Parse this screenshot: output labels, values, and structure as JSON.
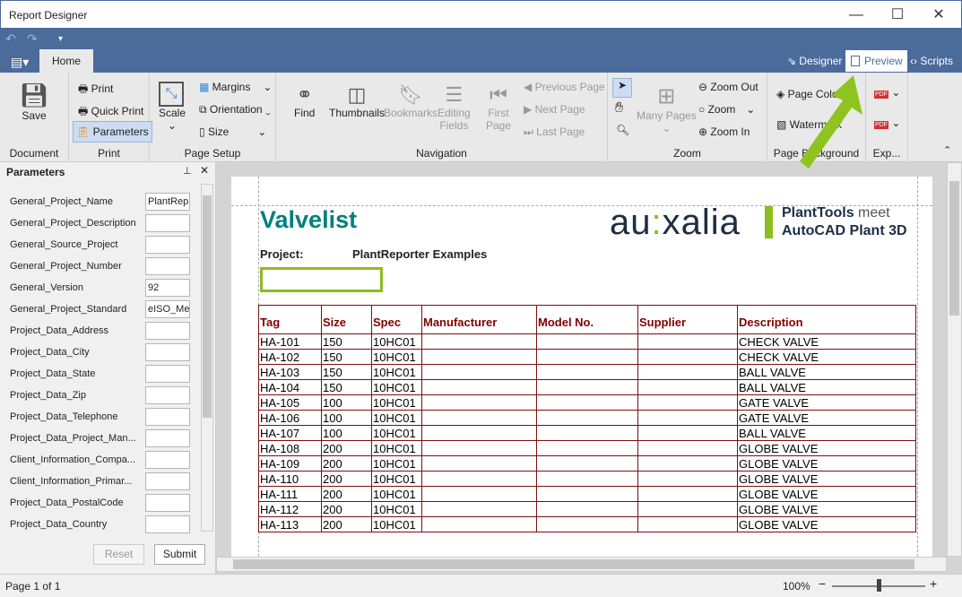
{
  "window": {
    "title": "Report Designer",
    "minimize": "—",
    "maximize": "☐",
    "close": "✕"
  },
  "quick_access": {
    "undo": "↶",
    "redo": "↷",
    "customize": "▾"
  },
  "tabs": [
    {
      "label": "Home"
    }
  ],
  "view_tabs": [
    {
      "label": "Designer",
      "icon": "designer-icon"
    },
    {
      "label": "Preview",
      "icon": "preview-icon"
    },
    {
      "label": "Scripts",
      "icon": "scripts-icon"
    }
  ],
  "ribbon": {
    "document": {
      "label": "Document",
      "save": "Save"
    },
    "print": {
      "label": "Print",
      "print": "Print",
      "quick_print": "Quick Print",
      "parameters": "Parameters"
    },
    "page_setup": {
      "label": "Page Setup",
      "scale": "Scale",
      "margins": "Margins",
      "orientation": "Orientation",
      "size": "Size"
    },
    "navigation": {
      "label": "Navigation",
      "find": "Find",
      "thumbnails": "Thumbnails",
      "bookmarks": "Bookmarks",
      "editing_fields_1": "Editing",
      "editing_fields_2": "Fields",
      "first_page_1": "First",
      "first_page_2": "Page",
      "previous_page": "Previous Page",
      "next_page": "Next Page",
      "last_page": "Last Page"
    },
    "zoom": {
      "label": "Zoom",
      "many_pages": "Many Pages",
      "zoom_out": "Zoom Out",
      "zoom": "Zoom",
      "zoom_in": "Zoom In"
    },
    "page_background": {
      "label": "Page Background",
      "page_color": "Page Color",
      "watermark": "Watermark"
    },
    "export": {
      "label": "Exp...",
      "pdf": "PDF"
    }
  },
  "parameters_panel": {
    "title": "Parameters",
    "reset": "Reset",
    "submit": "Submit",
    "items": [
      {
        "name": "General_Project_Name",
        "value": "PlantRep"
      },
      {
        "name": "General_Project_Description",
        "value": ""
      },
      {
        "name": "General_Source_Project",
        "value": ""
      },
      {
        "name": "General_Project_Number",
        "value": ""
      },
      {
        "name": "General_Version",
        "value": "92"
      },
      {
        "name": "General_Project_Standard",
        "value": "eISO_Me"
      },
      {
        "name": "Project_Data_Address",
        "value": ""
      },
      {
        "name": "Project_Data_City",
        "value": ""
      },
      {
        "name": "Project_Data_State",
        "value": ""
      },
      {
        "name": "Project_Data_Zip",
        "value": ""
      },
      {
        "name": "Project_Data_Telephone",
        "value": ""
      },
      {
        "name": "Project_Data_Project_Man...",
        "value": ""
      },
      {
        "name": "Client_Information_Compa...",
        "value": ""
      },
      {
        "name": "Client_Information_Primar...",
        "value": ""
      },
      {
        "name": "Project_Data_PostalCode",
        "value": ""
      },
      {
        "name": "Project_Data_Country",
        "value": ""
      }
    ]
  },
  "report": {
    "title": "Valvelist",
    "project_label": "Project:",
    "project_value": "PlantReporter Examples",
    "logo": {
      "brand": "au:xalia",
      "tagline1": "PlantTools meet",
      "tagline2": "AutoCAD Plant 3D"
    },
    "columns": [
      "Tag",
      "Size",
      "Spec",
      "Manufacturer",
      "Model No.",
      "Supplier",
      "Description"
    ],
    "rows": [
      [
        "HA-101",
        "150",
        "10HC01",
        "",
        "",
        "",
        "CHECK VALVE"
      ],
      [
        "HA-102",
        "150",
        "10HC01",
        "",
        "",
        "",
        "CHECK VALVE"
      ],
      [
        "HA-103",
        "150",
        "10HC01",
        "",
        "",
        "",
        "BALL VALVE"
      ],
      [
        "HA-104",
        "150",
        "10HC01",
        "",
        "",
        "",
        "BALL VALVE"
      ],
      [
        "HA-105",
        "100",
        "10HC01",
        "",
        "",
        "",
        "GATE VALVE"
      ],
      [
        "HA-106",
        "100",
        "10HC01",
        "",
        "",
        "",
        "GATE VALVE"
      ],
      [
        "HA-107",
        "100",
        "10HC01",
        "",
        "",
        "",
        "BALL VALVE"
      ],
      [
        "HA-108",
        "200",
        "10HC01",
        "",
        "",
        "",
        "GLOBE VALVE"
      ],
      [
        "HA-109",
        "200",
        "10HC01",
        "",
        "",
        "",
        "GLOBE VALVE"
      ],
      [
        "HA-110",
        "200",
        "10HC01",
        "",
        "",
        "",
        "GLOBE VALVE"
      ],
      [
        "HA-111",
        "200",
        "10HC01",
        "",
        "",
        "",
        "GLOBE VALVE"
      ],
      [
        "HA-112",
        "200",
        "10HC01",
        "",
        "",
        "",
        "GLOBE VALVE"
      ],
      [
        "HA-113",
        "200",
        "10HC01",
        "",
        "",
        "",
        "GLOBE VALVE"
      ]
    ]
  },
  "status": {
    "page": "Page 1 of 1",
    "zoom": "100%",
    "zoom_level_percent": 100
  },
  "colors": {
    "accent": "#4b6b9b",
    "title": "#00807f",
    "table_border": "#7a1010",
    "header_text": "#800000",
    "highlight_box": "#8fbc1f",
    "arrow": "#8fc31f"
  }
}
